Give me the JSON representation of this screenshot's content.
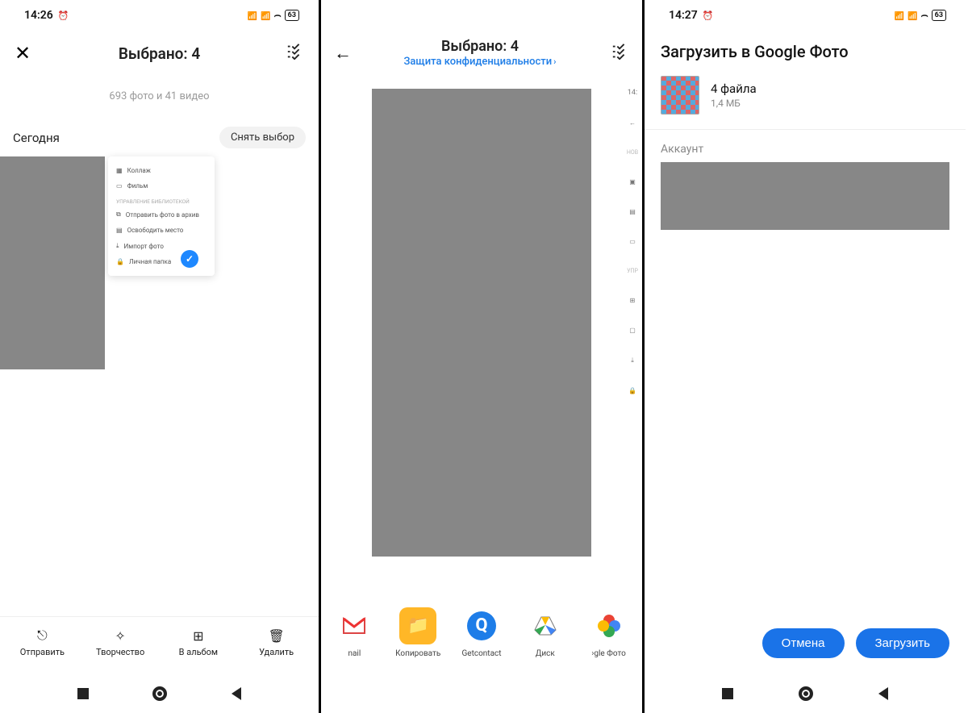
{
  "phones": {
    "s1": {
      "status": {
        "time": "14:26",
        "battery": "63"
      },
      "title": "Выбрано: 4",
      "subtitle": "693 фото и 41 видео",
      "today": "Сегодня",
      "deselect": "Снять выбор",
      "menu": {
        "collage": "Коллаж",
        "film": "Фильм",
        "section": "Управление библиотекой",
        "archive": "Отправить фото в архив",
        "freeup": "Освободить место",
        "import": "Импорт фото",
        "locked": "Личная папка"
      },
      "actions": {
        "send": "Отправить",
        "create": "Творчество",
        "toalbum": "В альбом",
        "delete": "Удалить"
      }
    },
    "s2": {
      "title": "Выбрано: 4",
      "privacy": "Защита конфиденциальности",
      "rail": {
        "new": "НОВ",
        "mgmt": "УПР"
      },
      "share": {
        "gmail": "nail",
        "copy": "Копировать",
        "getcontact": "Getcontact",
        "drive": "Диск",
        "photos": "›gle Фото"
      }
    },
    "s3": {
      "status": {
        "time": "14:27",
        "battery": "63"
      },
      "title": "Загрузить в Google Фото",
      "files_main": "4 файла",
      "files_sub": "1,4 МБ",
      "account": "Аккаунт",
      "cancel": "Отмена",
      "upload": "Загрузить"
    }
  }
}
